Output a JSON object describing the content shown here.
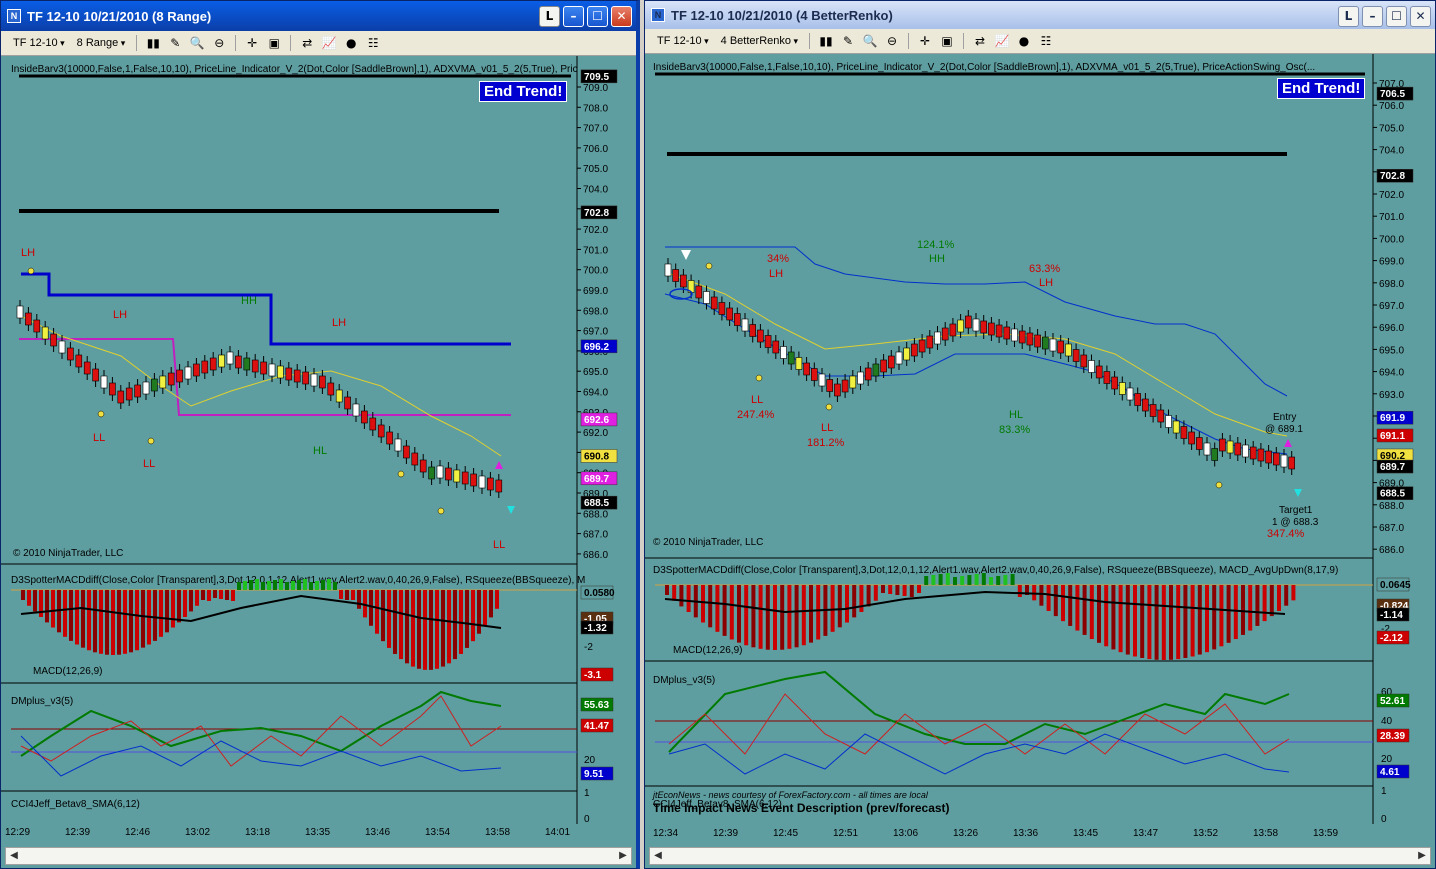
{
  "left": {
    "title": "TF 12-10  10/21/2010 (8 Range)",
    "toolbar": {
      "instrument": "TF 12-10",
      "period": "8 Range"
    },
    "indicator_line": "InsideBarv3(10000,False,1,False,10,10), PriceLine_Indicator_V_2(Dot,Color [SaddleBrown],1),  ADXVMA_v01_5_2(5,True), Pric",
    "end_trend": "End Trend!",
    "copyright": "© 2010 NinjaTrader, LLC",
    "price_axis": [
      "709.0",
      "708.0",
      "707.0",
      "706.0",
      "705.0",
      "704.0",
      "703.0",
      "702.0",
      "701.0",
      "700.0",
      "699.0",
      "698.0",
      "697.0",
      "696.0",
      "695.0",
      "694.0",
      "693.0",
      "692.0",
      "691.0",
      "690.0",
      "689.0",
      "688.0",
      "687.0",
      "686.0"
    ],
    "price_tags": [
      {
        "v": "709.5",
        "bg": "#000000",
        "fg": "#ffffff"
      },
      {
        "v": "702.8",
        "bg": "#000000",
        "fg": "#ffffff"
      },
      {
        "v": "696.2",
        "bg": "#0000cc",
        "fg": "#ffffff"
      },
      {
        "v": "692.6",
        "bg": "#e020e0",
        "fg": "#ffffff"
      },
      {
        "v": "690.8",
        "bg": "#f0e040",
        "fg": "#000000"
      },
      {
        "v": "689.7",
        "bg": "#e020e0",
        "fg": "#ffffff"
      },
      {
        "v": "688.5",
        "bg": "#000000",
        "fg": "#ffffff"
      }
    ],
    "swing_labels": [
      {
        "t": "LH",
        "c": "#cc0000"
      },
      {
        "t": "LH",
        "c": "#cc0000"
      },
      {
        "t": "HH",
        "c": "#007a00"
      },
      {
        "t": "LH",
        "c": "#cc0000"
      },
      {
        "t": "LL",
        "c": "#cc0000"
      },
      {
        "t": "LL",
        "c": "#cc0000"
      },
      {
        "t": "HL",
        "c": "#007a00"
      },
      {
        "t": "LL",
        "c": "#cc0000"
      }
    ],
    "macd_panel": {
      "label": "D3SpotterMACDdiff(Close,Color [Transparent],3,Dot,12,0,1,12,Alert1.wav,Alert2.wav,0,40,26,9,False), RSqueeze(BBSqueeze), M",
      "sublabel": "MACD(12,26,9)",
      "axis": [
        "0",
        "-2"
      ],
      "tags": [
        {
          "v": "0.0580",
          "bg": "#5f9ea0",
          "fg": "#000000"
        },
        {
          "v": "-1.05",
          "bg": "#5a3010",
          "fg": "#ffffff"
        },
        {
          "v": "-1.32",
          "bg": "#000000",
          "fg": "#ffffff"
        },
        {
          "v": "-3.1",
          "bg": "#cc0000",
          "fg": "#ffffff"
        }
      ]
    },
    "dm_panel": {
      "label": "DMplus_v3(5)",
      "axis": [
        "60",
        "40",
        "20"
      ],
      "tags": [
        {
          "v": "55.63",
          "bg": "#007a00",
          "fg": "#ffffff"
        },
        {
          "v": "41.47",
          "bg": "#cc0000",
          "fg": "#ffffff"
        },
        {
          "v": "9.51",
          "bg": "#0000cc",
          "fg": "#ffffff"
        }
      ]
    },
    "cci_panel": {
      "label": "CCI4Jeff_Betav8_SMA(6,12)",
      "axis": [
        "1",
        "0"
      ]
    },
    "time_axis": [
      "12:29",
      "12:39",
      "12:46",
      "13:02",
      "13:18",
      "13:35",
      "13:46",
      "13:54",
      "13:58",
      "14:01"
    ]
  },
  "right": {
    "title": "TF 12-10  10/21/2010 (4 BetterRenko)",
    "toolbar": {
      "instrument": "TF 12-10",
      "period": "4 BetterRenko"
    },
    "indicator_line": "InsideBarv3(10000,False,1,False,10,10), PriceLine_Indicator_V_2(Dot,Color [SaddleBrown],1),  ADXVMA_v01_5_2(5,True), PriceActionSwing_Osc(...",
    "end_trend": "End Trend!",
    "copyright": "© 2010 NinjaTrader, LLC",
    "price_axis": [
      "707.0",
      "706.0",
      "705.0",
      "704.0",
      "703.0",
      "702.0",
      "701.0",
      "700.0",
      "699.0",
      "698.0",
      "697.0",
      "696.0",
      "695.0",
      "694.0",
      "693.0",
      "692.0",
      "691.0",
      "690.0",
      "689.0",
      "688.0",
      "687.0",
      "686.0"
    ],
    "price_tags": [
      {
        "v": "706.5",
        "bg": "#000000",
        "fg": "#ffffff"
      },
      {
        "v": "702.8",
        "bg": "#000000",
        "fg": "#ffffff"
      },
      {
        "v": "691.9",
        "bg": "#0000cc",
        "fg": "#ffffff"
      },
      {
        "v": "691.1",
        "bg": "#cc0000",
        "fg": "#ffffff"
      },
      {
        "v": "690.2",
        "bg": "#f0e040",
        "fg": "#000000"
      },
      {
        "v": "689.7",
        "bg": "#000000",
        "fg": "#ffffff"
      },
      {
        "v": "688.5",
        "bg": "#000000",
        "fg": "#ffffff"
      }
    ],
    "swing_labels": [
      {
        "t": "34%",
        "c": "#cc0000"
      },
      {
        "t": "LH",
        "c": "#cc0000"
      },
      {
        "t": "124.1%",
        "c": "#007a00"
      },
      {
        "t": "HH",
        "c": "#007a00"
      },
      {
        "t": "63.3%",
        "c": "#cc0000"
      },
      {
        "t": "LH",
        "c": "#cc0000"
      },
      {
        "t": "LL",
        "c": "#cc0000"
      },
      {
        "t": "247.4%",
        "c": "#cc0000"
      },
      {
        "t": "LL",
        "c": "#cc0000"
      },
      {
        "t": "181.2%",
        "c": "#cc0000"
      },
      {
        "t": "HL",
        "c": "#007a00"
      },
      {
        "t": "83.3%",
        "c": "#007a00"
      }
    ],
    "entry": {
      "label": "Entry",
      "detail": "@ 689.1"
    },
    "target": {
      "label": "Target1",
      "detail": "1 @ 688.3",
      "pct": "347.4%"
    },
    "macd_panel": {
      "label": "D3SpotterMACDdiff(Close,Color [Transparent],3,Dot,12,0,1,12,Alert1.wav,Alert2.wav,0,40,26,9,False), RSqueeze(BBSqueeze), MACD_AvgUpDwn(8,17,9)",
      "sublabel": "MACD(12,26,9)",
      "axis": [
        "0",
        "-2"
      ],
      "tags": [
        {
          "v": "0.0645",
          "bg": "#5f9ea0",
          "fg": "#000000"
        },
        {
          "v": "-0.824",
          "bg": "#5a3010",
          "fg": "#ffffff"
        },
        {
          "v": "-1.14",
          "bg": "#000000",
          "fg": "#ffffff"
        },
        {
          "v": "-2.12",
          "bg": "#cc0000",
          "fg": "#ffffff"
        }
      ]
    },
    "dm_panel": {
      "label": "DMplus_v3(5)",
      "axis": [
        "60",
        "40",
        "20"
      ],
      "tags": [
        {
          "v": "52.61",
          "bg": "#007a00",
          "fg": "#ffffff"
        },
        {
          "v": "28.39",
          "bg": "#cc0000",
          "fg": "#ffffff"
        },
        {
          "v": "4.61",
          "bg": "#0000cc",
          "fg": "#ffffff"
        }
      ]
    },
    "cci_panel": {
      "label": "CCI4Jeff_Betav8_SMA(6,12)",
      "axis": [
        "1",
        "0"
      ]
    },
    "news": {
      "credit": "jtEconNews - news courtesy of ForexFactory.com - all times are local",
      "header": "Time    Impact    News Event Description (prev/forecast)"
    },
    "time_axis": [
      "12:34",
      "12:39",
      "12:45",
      "12:51",
      "13:06",
      "13:26",
      "13:36",
      "13:45",
      "13:47",
      "13:52",
      "13:58",
      "13:59"
    ]
  }
}
